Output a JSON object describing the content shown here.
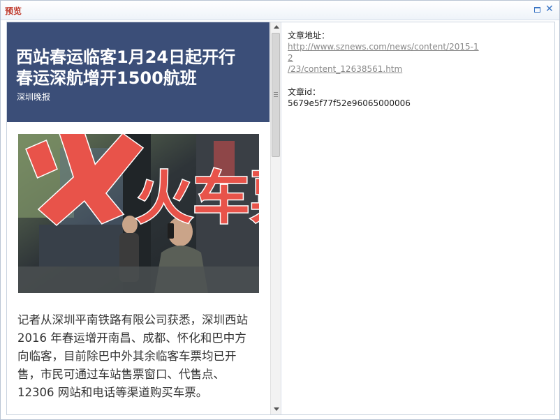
{
  "window": {
    "title": "预览",
    "maximize_icon": "maximize-icon",
    "close_icon": "close-icon",
    "close_glyph": "✕"
  },
  "article": {
    "headline_line1": "西站春运临客1月24日起开行",
    "headline_line2": "春运深航增开1500航班",
    "source": "深圳晚报",
    "photo_text": "火车票",
    "body_lines": [
      "记者从深圳平南铁路有限公司获悉，深圳西站",
      "2016 年春运增开南昌、成都、怀化和巴中方",
      "向临客，目前除巴中外其余临客车票均已开",
      "售，市民可通过车站售票窗口、代售点、",
      "12306 网站和电话等渠道购买车票。"
    ]
  },
  "info": {
    "url_label": "文章地址：",
    "url_line1": "http://www.sznews.com/news/content/2015-12",
    "url_line2": "/23/content_12638561.htm",
    "id_label": "文章id：",
    "id_value": "5679e5f77f52e96065000006"
  },
  "colors": {
    "title": "#c0392b",
    "header_bg": "#3b4e78",
    "link": "#888888",
    "accent": "#3b75c4"
  }
}
